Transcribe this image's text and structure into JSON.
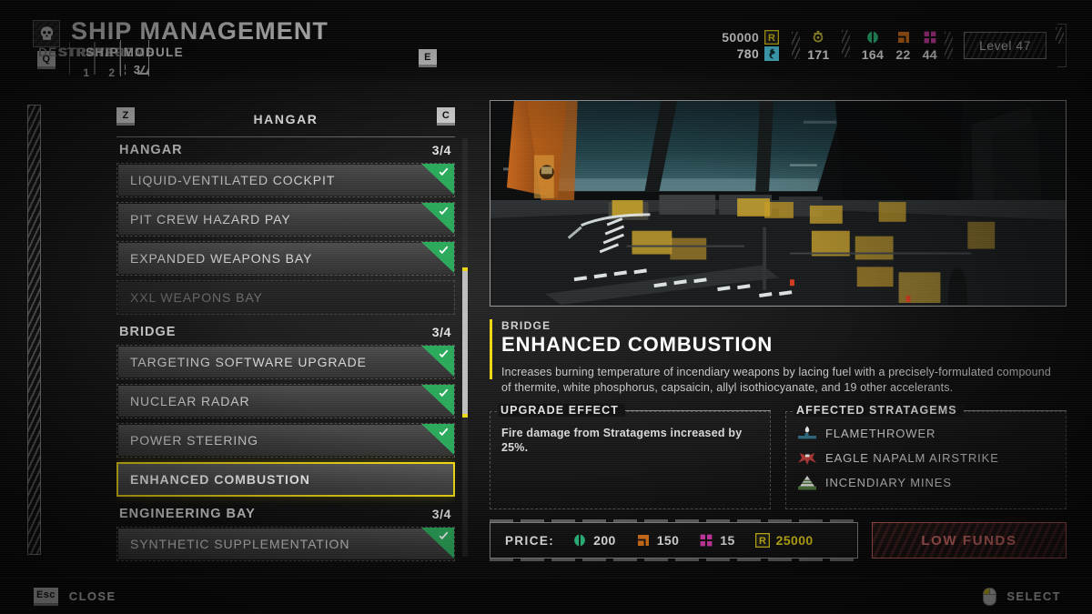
{
  "header": {
    "title": "SHIP MANAGEMENT",
    "skull_icon": "skull-icon",
    "prev_key": "Q",
    "next_key": "E",
    "tabs": [
      {
        "label": "DESTROYER",
        "num": "1",
        "active": false
      },
      {
        "label": "STRATAGEMS",
        "num": "2",
        "active": false
      },
      {
        "label": "SHIP MODULE",
        "num": "3",
        "active": true
      }
    ]
  },
  "resources": {
    "requisition": {
      "value": "50000",
      "icon": "requisition-icon",
      "color": "#edd613"
    },
    "medals": {
      "value": "780",
      "icon": "medal-icon",
      "color": "#4fd7f0"
    },
    "samples_common": {
      "value": "171",
      "icon": "common-sample-icon",
      "color": "#cfc23a"
    },
    "samples_rare": {
      "value": "164",
      "icon": "rare-sample-icon",
      "color": "#2fd18a"
    },
    "samples_super": {
      "value": "22",
      "icon": "super-sample-icon",
      "color": "#ef7d18"
    },
    "samples_pink": {
      "value": "44",
      "icon": "pink-sample-icon",
      "color": "#ee3fbd"
    },
    "level_label": "Level 47"
  },
  "list": {
    "prev_key": "Z",
    "next_key": "C",
    "title": "HANGAR",
    "sections": [
      {
        "name": "HANGAR",
        "count": "3/4",
        "items": [
          {
            "label": "LIQUID-VENTILATED COCKPIT",
            "state": "owned"
          },
          {
            "label": "PIT CREW HAZARD PAY",
            "state": "owned"
          },
          {
            "label": "EXPANDED WEAPONS BAY",
            "state": "owned"
          },
          {
            "label": "XXL WEAPONS BAY",
            "state": "locked"
          }
        ]
      },
      {
        "name": "BRIDGE",
        "count": "3/4",
        "items": [
          {
            "label": "TARGETING SOFTWARE UPGRADE",
            "state": "owned"
          },
          {
            "label": "NUCLEAR RADAR",
            "state": "owned"
          },
          {
            "label": "POWER STEERING",
            "state": "owned"
          },
          {
            "label": "ENHANCED COMBUSTION",
            "state": "selected"
          }
        ]
      },
      {
        "name": "ENGINEERING BAY",
        "count": "3/4",
        "items": [
          {
            "label": "SYNTHETIC SUPPLEMENTATION",
            "state": "owned"
          }
        ]
      }
    ]
  },
  "detail": {
    "category": "BRIDGE",
    "title": "ENHANCED COMBUSTION",
    "description": "Increases burning temperature of incendiary weapons by lacing fuel with a precisely-formulated compound of thermite, white phosphorus, capsaicin, allyl isothiocyanate, and 19 other accelerants.",
    "effect_heading": "UPGRADE EFFECT",
    "effect_text": "Fire damage from Stratagems increased by 25%.",
    "stratagems_heading": "AFFECTED STRATAGEMS",
    "stratagems": [
      {
        "name": "FLAMETHROWER",
        "icon": "flamethrower-icon"
      },
      {
        "name": "EAGLE NAPALM AIRSTRIKE",
        "icon": "eagle-napalm-icon"
      },
      {
        "name": "INCENDIARY MINES",
        "icon": "incendiary-mines-icon"
      }
    ]
  },
  "price": {
    "label": "PRICE:",
    "items": [
      {
        "value": "200",
        "icon": "rare-sample-icon",
        "color": "#2fd18a"
      },
      {
        "value": "150",
        "icon": "super-sample-icon",
        "color": "#ef7d18"
      },
      {
        "value": "15",
        "icon": "pink-sample-icon",
        "color": "#ee3fbd"
      },
      {
        "value": "25000",
        "icon": "requisition-icon",
        "color": "#edd613"
      }
    ],
    "buy_label": "LOW FUNDS"
  },
  "footer": {
    "close_key": "Esc",
    "close_label": "CLOSE",
    "select_icon": "mouse-left-click-icon",
    "select_label": "SELECT"
  }
}
